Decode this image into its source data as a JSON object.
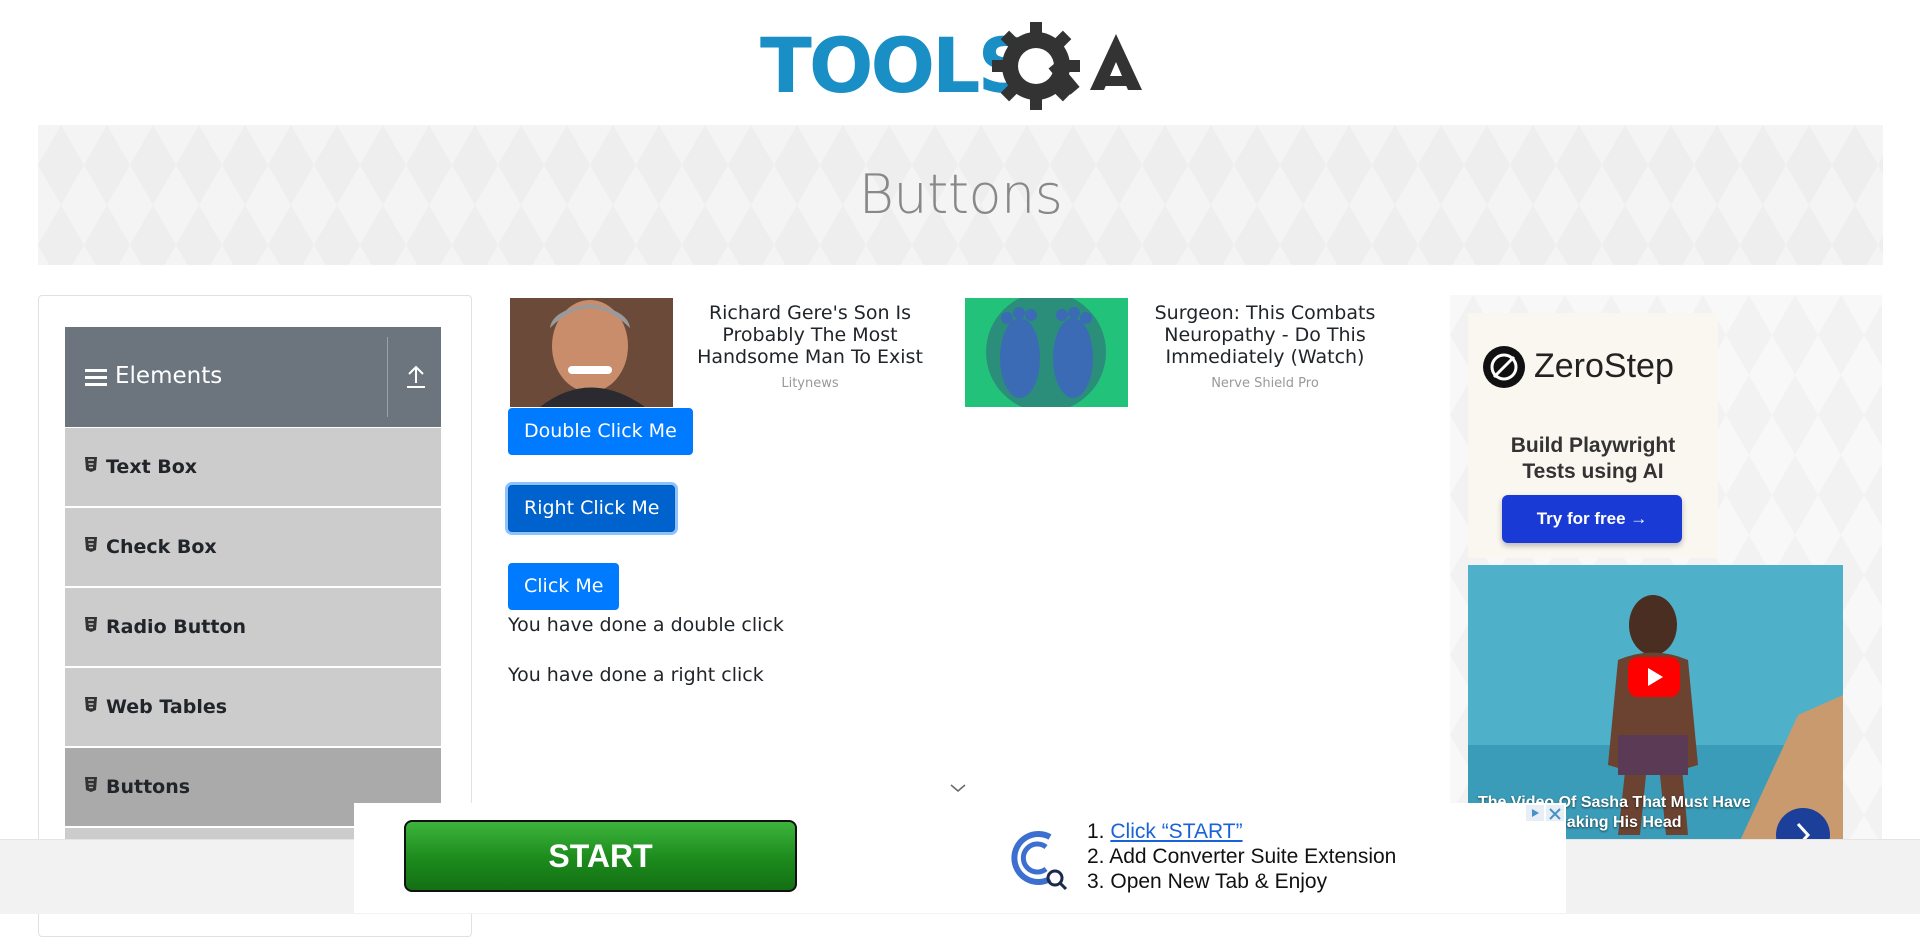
{
  "header": {
    "logo_text": "TOOLSQA",
    "page_title": "Buttons"
  },
  "sidebar": {
    "group_title": "Elements",
    "items": [
      {
        "label": "Text Box"
      },
      {
        "label": "Check Box"
      },
      {
        "label": "Radio Button"
      },
      {
        "label": "Web Tables"
      },
      {
        "label": "Buttons",
        "active": true
      }
    ]
  },
  "ads_top": [
    {
      "headline": "Richard Gere's Son Is Probably The Most Handsome Man To Exist",
      "source": "Litynews"
    },
    {
      "headline": "Surgeon: This Combats Neuropathy - Do This Immediately (Watch)",
      "source": "Nerve Shield Pro"
    }
  ],
  "buttons": {
    "double_click": "Double Click Me",
    "right_click": "Right Click Me",
    "click": "Click Me"
  },
  "messages": {
    "double_click": "You have done a double click",
    "right_click": "You have done a right click"
  },
  "right_ad": {
    "brand": "ZeroStep",
    "tagline_1": "Build Playwright",
    "tagline_2": "Tests using AI",
    "cta": "Try for free →",
    "video_caption_1": "The Video Of Sasha That Must Have",
    "video_caption_2": "a Shaking His Head"
  },
  "bottom_ad": {
    "start_label": "START",
    "step1": "Click “START”",
    "step2": "Add Converter Suite Extension",
    "step3": "Open New Tab & Enjoy"
  },
  "colors": {
    "primary": "#007bff",
    "sidebar_header": "#6c757d",
    "menu_item": "#cccccc",
    "menu_active": "#aaaaaa"
  }
}
